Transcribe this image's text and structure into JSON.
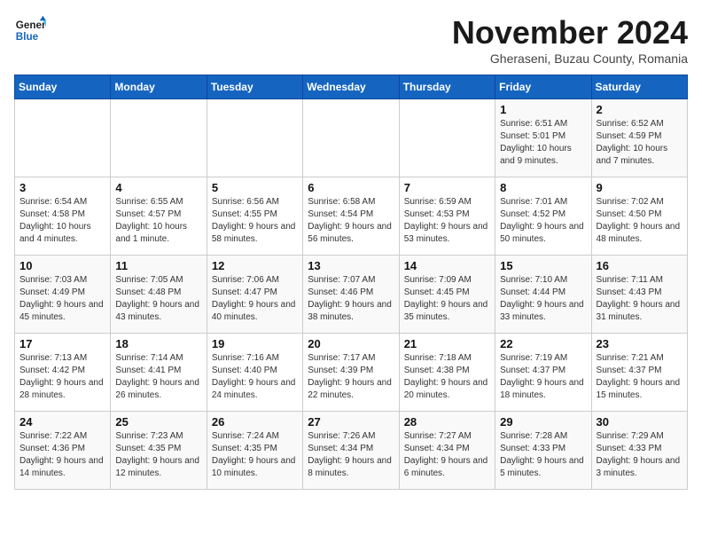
{
  "header": {
    "logo_line1": "General",
    "logo_line2": "Blue",
    "month": "November 2024",
    "location": "Gheraseni, Buzau County, Romania"
  },
  "days_of_week": [
    "Sunday",
    "Monday",
    "Tuesday",
    "Wednesday",
    "Thursday",
    "Friday",
    "Saturday"
  ],
  "weeks": [
    [
      {
        "day": "",
        "info": ""
      },
      {
        "day": "",
        "info": ""
      },
      {
        "day": "",
        "info": ""
      },
      {
        "day": "",
        "info": ""
      },
      {
        "day": "",
        "info": ""
      },
      {
        "day": "1",
        "info": "Sunrise: 6:51 AM\nSunset: 5:01 PM\nDaylight: 10 hours and 9 minutes."
      },
      {
        "day": "2",
        "info": "Sunrise: 6:52 AM\nSunset: 4:59 PM\nDaylight: 10 hours and 7 minutes."
      }
    ],
    [
      {
        "day": "3",
        "info": "Sunrise: 6:54 AM\nSunset: 4:58 PM\nDaylight: 10 hours and 4 minutes."
      },
      {
        "day": "4",
        "info": "Sunrise: 6:55 AM\nSunset: 4:57 PM\nDaylight: 10 hours and 1 minute."
      },
      {
        "day": "5",
        "info": "Sunrise: 6:56 AM\nSunset: 4:55 PM\nDaylight: 9 hours and 58 minutes."
      },
      {
        "day": "6",
        "info": "Sunrise: 6:58 AM\nSunset: 4:54 PM\nDaylight: 9 hours and 56 minutes."
      },
      {
        "day": "7",
        "info": "Sunrise: 6:59 AM\nSunset: 4:53 PM\nDaylight: 9 hours and 53 minutes."
      },
      {
        "day": "8",
        "info": "Sunrise: 7:01 AM\nSunset: 4:52 PM\nDaylight: 9 hours and 50 minutes."
      },
      {
        "day": "9",
        "info": "Sunrise: 7:02 AM\nSunset: 4:50 PM\nDaylight: 9 hours and 48 minutes."
      }
    ],
    [
      {
        "day": "10",
        "info": "Sunrise: 7:03 AM\nSunset: 4:49 PM\nDaylight: 9 hours and 45 minutes."
      },
      {
        "day": "11",
        "info": "Sunrise: 7:05 AM\nSunset: 4:48 PM\nDaylight: 9 hours and 43 minutes."
      },
      {
        "day": "12",
        "info": "Sunrise: 7:06 AM\nSunset: 4:47 PM\nDaylight: 9 hours and 40 minutes."
      },
      {
        "day": "13",
        "info": "Sunrise: 7:07 AM\nSunset: 4:46 PM\nDaylight: 9 hours and 38 minutes."
      },
      {
        "day": "14",
        "info": "Sunrise: 7:09 AM\nSunset: 4:45 PM\nDaylight: 9 hours and 35 minutes."
      },
      {
        "day": "15",
        "info": "Sunrise: 7:10 AM\nSunset: 4:44 PM\nDaylight: 9 hours and 33 minutes."
      },
      {
        "day": "16",
        "info": "Sunrise: 7:11 AM\nSunset: 4:43 PM\nDaylight: 9 hours and 31 minutes."
      }
    ],
    [
      {
        "day": "17",
        "info": "Sunrise: 7:13 AM\nSunset: 4:42 PM\nDaylight: 9 hours and 28 minutes."
      },
      {
        "day": "18",
        "info": "Sunrise: 7:14 AM\nSunset: 4:41 PM\nDaylight: 9 hours and 26 minutes."
      },
      {
        "day": "19",
        "info": "Sunrise: 7:16 AM\nSunset: 4:40 PM\nDaylight: 9 hours and 24 minutes."
      },
      {
        "day": "20",
        "info": "Sunrise: 7:17 AM\nSunset: 4:39 PM\nDaylight: 9 hours and 22 minutes."
      },
      {
        "day": "21",
        "info": "Sunrise: 7:18 AM\nSunset: 4:38 PM\nDaylight: 9 hours and 20 minutes."
      },
      {
        "day": "22",
        "info": "Sunrise: 7:19 AM\nSunset: 4:37 PM\nDaylight: 9 hours and 18 minutes."
      },
      {
        "day": "23",
        "info": "Sunrise: 7:21 AM\nSunset: 4:37 PM\nDaylight: 9 hours and 15 minutes."
      }
    ],
    [
      {
        "day": "24",
        "info": "Sunrise: 7:22 AM\nSunset: 4:36 PM\nDaylight: 9 hours and 14 minutes."
      },
      {
        "day": "25",
        "info": "Sunrise: 7:23 AM\nSunset: 4:35 PM\nDaylight: 9 hours and 12 minutes."
      },
      {
        "day": "26",
        "info": "Sunrise: 7:24 AM\nSunset: 4:35 PM\nDaylight: 9 hours and 10 minutes."
      },
      {
        "day": "27",
        "info": "Sunrise: 7:26 AM\nSunset: 4:34 PM\nDaylight: 9 hours and 8 minutes."
      },
      {
        "day": "28",
        "info": "Sunrise: 7:27 AM\nSunset: 4:34 PM\nDaylight: 9 hours and 6 minutes."
      },
      {
        "day": "29",
        "info": "Sunrise: 7:28 AM\nSunset: 4:33 PM\nDaylight: 9 hours and 5 minutes."
      },
      {
        "day": "30",
        "info": "Sunrise: 7:29 AM\nSunset: 4:33 PM\nDaylight: 9 hours and 3 minutes."
      }
    ]
  ]
}
